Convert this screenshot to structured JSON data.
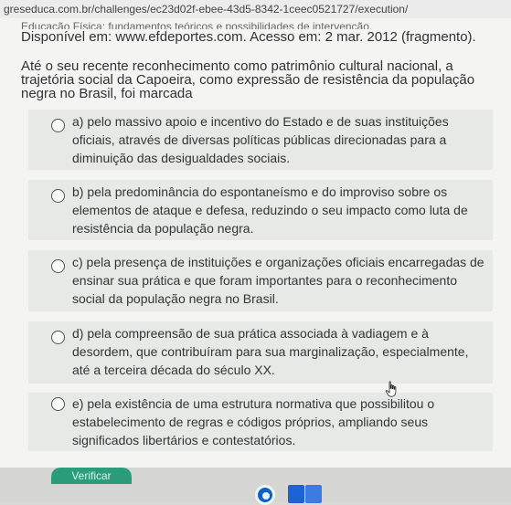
{
  "browser": {
    "url": "greseduca.com.br/challenges/ec23d02f-ebee-43d5-8342-1ceec0521727/execution/"
  },
  "question": {
    "source_cut": "Educação Física: fundamentos teóricos e possibilidades de intervenção.",
    "source_reference": "Disponível em: www.efdeportes.com. Acesso em: 2 mar. 2012 (fragmento).",
    "prompt": "Até o seu recente reconhecimento como patrimônio cultural nacional, a trajetória social da Capoeira, como expressão de resistência da população negra no Brasil, foi marcada"
  },
  "options": [
    {
      "key": "a",
      "text": "a) pelo massivo apoio e incentivo do Estado e de suas instituições oficiais, através de diversas políticas públicas direcionadas para a diminuição das desigualdades sociais."
    },
    {
      "key": "b",
      "text": "b) pela predominância do espontaneísmo e do improviso sobre os elementos de ataque e defesa, reduzindo o seu impacto como luta de resistência da população negra."
    },
    {
      "key": "c",
      "text": "c) pela presença de instituições e organizações oficiais encarregadas de ensinar sua prática e que foram importantes para o reconhecimento social da população negra no Brasil."
    },
    {
      "key": "d",
      "text": "d) pela compreensão de sua prática associada à vadiagem e à desordem, que contribuíram para sua marginalização, especialmente, até a terceira década do século XX."
    },
    {
      "key": "e",
      "text": "e) pela existência de uma estrutura normativa que possibilitou o estabelecimento de regras e códigos próprios, ampliando seus significados libertários e contestatórios."
    }
  ],
  "footer": {
    "submit_label": "Verificar"
  },
  "icons": {
    "cursor": "hand-pointer-icon",
    "bottom_icon_1": "taskbar-app-icon",
    "bottom_icon_2": "taskbar-window-icon",
    "bottom_icon_3": "taskbar-window-icon"
  },
  "colors": {
    "background": "#f4f5f3",
    "option_background": "#e7e9e6",
    "text": "#303235",
    "submit_background": "#2c9d7b"
  }
}
